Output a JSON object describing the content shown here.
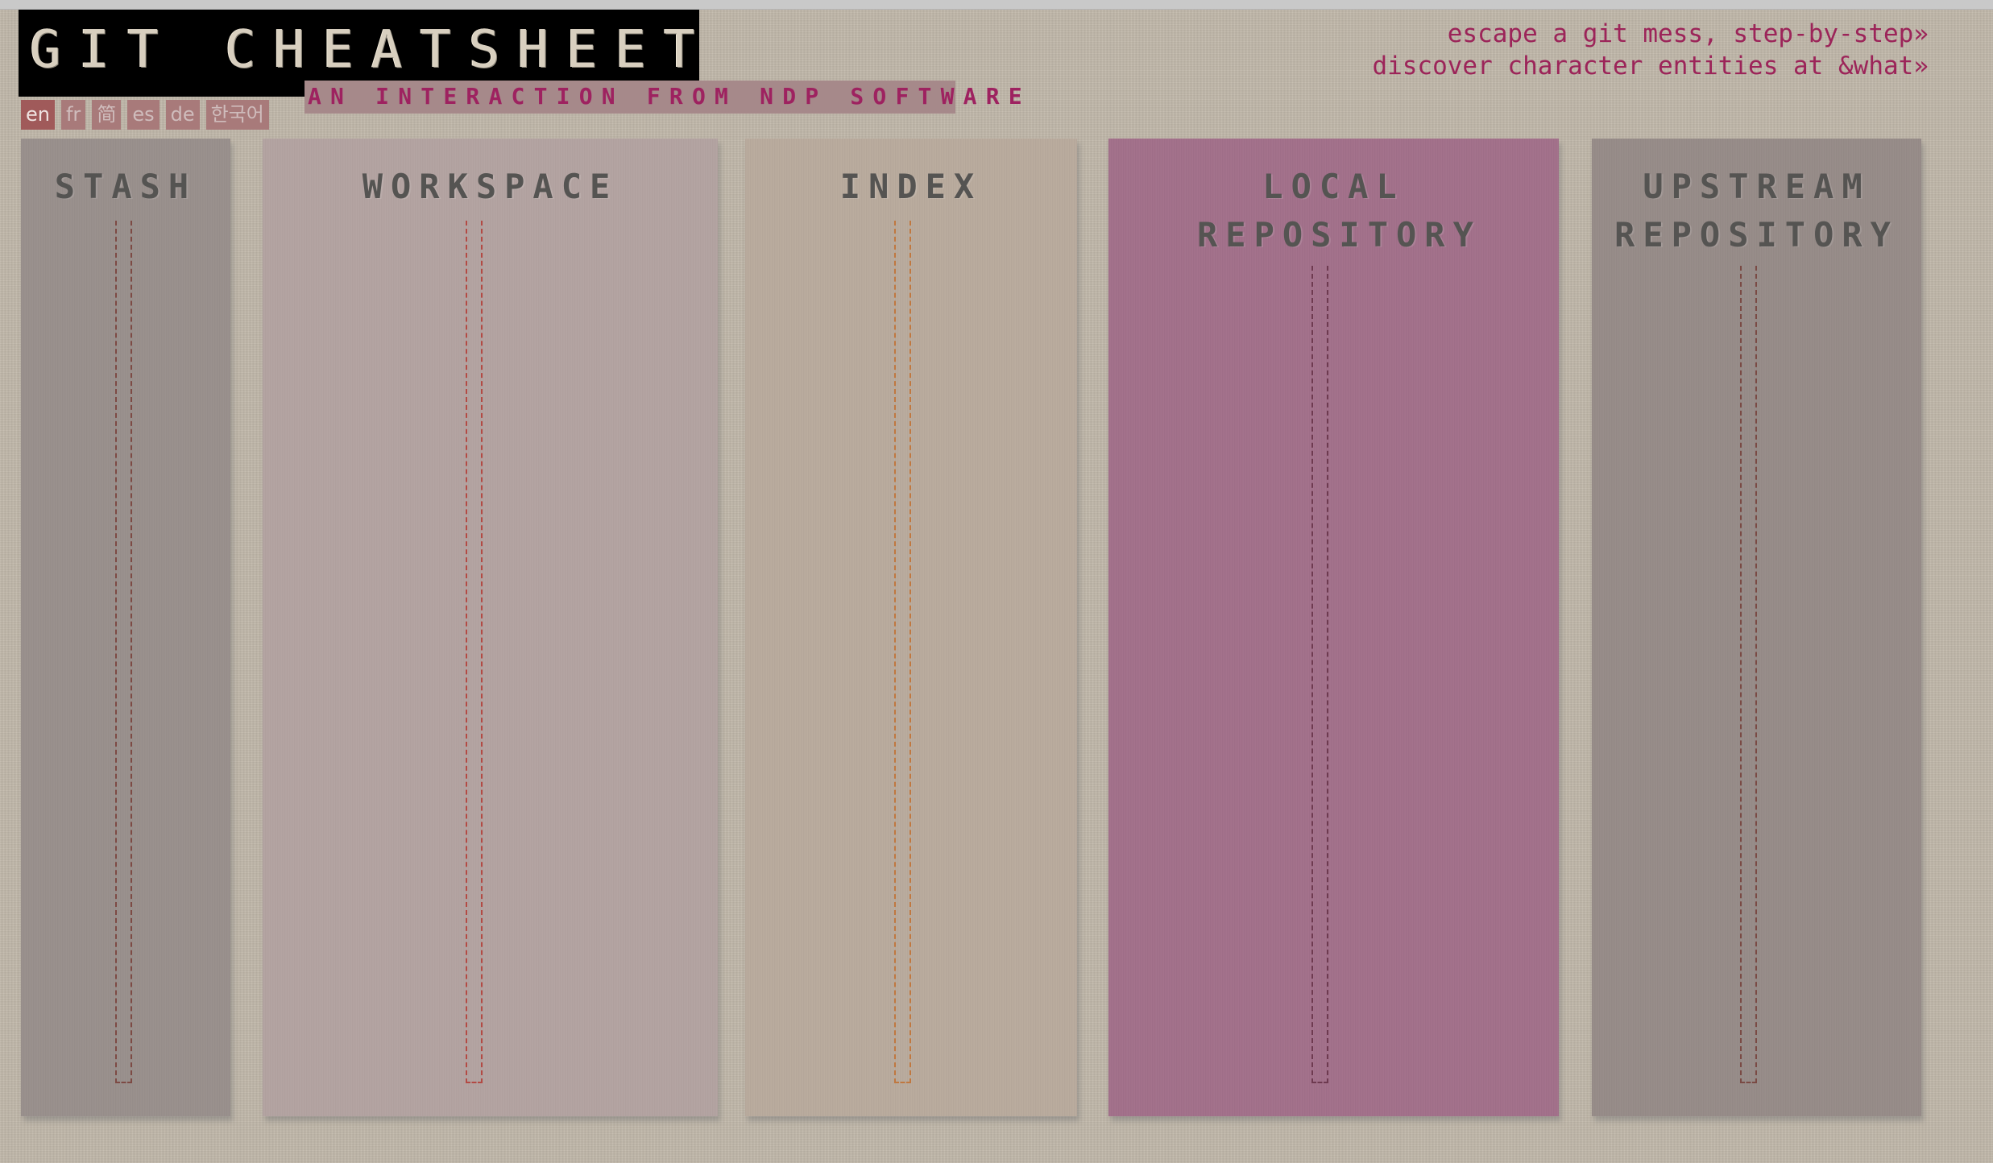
{
  "header": {
    "title": "GIT CHEATSHEET",
    "subtitle": "AN INTERACTION FROM NDP SOFTWARE"
  },
  "languages": [
    {
      "code": "en",
      "label": "en",
      "active": true
    },
    {
      "code": "fr",
      "label": "fr",
      "active": false
    },
    {
      "code": "zh",
      "label": "简",
      "active": false
    },
    {
      "code": "es",
      "label": "es",
      "active": false
    },
    {
      "code": "de",
      "label": "de",
      "active": false
    },
    {
      "code": "ko",
      "label": "한국어",
      "active": false
    }
  ],
  "links": [
    {
      "label": "escape a git mess, step-by-step»"
    },
    {
      "label": "discover character entities at &what»"
    }
  ],
  "panels": [
    {
      "id": "stash",
      "title": "STASH",
      "color": "#9a908d"
    },
    {
      "id": "workspace",
      "title": "WORKSPACE",
      "color": "#b4a4a2"
    },
    {
      "id": "index",
      "title": "INDEX",
      "color": "#b9ab9e"
    },
    {
      "id": "local",
      "title": "LOCAL REPOSITORY",
      "color": "#a3718b"
    },
    {
      "id": "upstream",
      "title": "UPSTREAM REPOSITORY",
      "color": "#978c89"
    }
  ],
  "colors": {
    "accent": "#9c2459",
    "background": "#bfb6a8",
    "title_bg": "#000000",
    "subtitle_bg": "#a6898a"
  }
}
